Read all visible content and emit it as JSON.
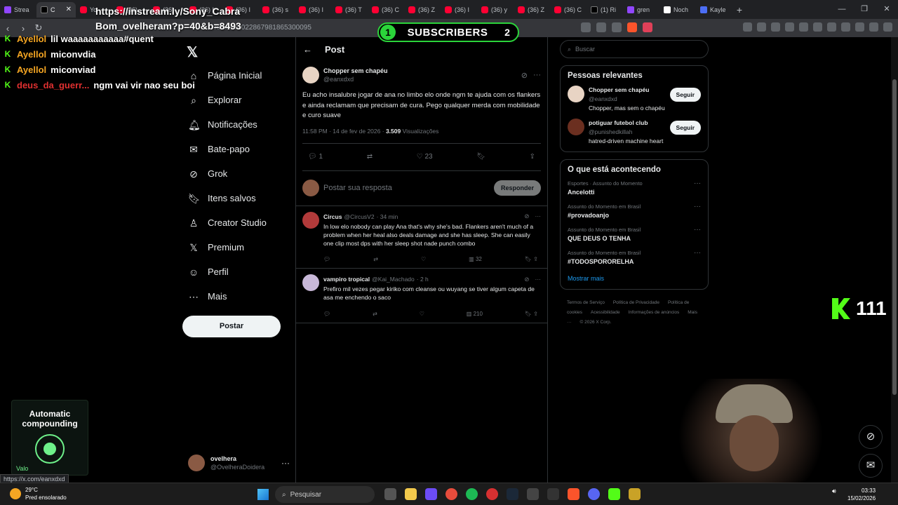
{
  "browser": {
    "tabs": [
      {
        "label": "Strea",
        "icon": "twitch-icon"
      },
      {
        "label": "C",
        "icon": "x-icon",
        "active": true
      },
      {
        "label": "Yo",
        "icon": "youtube-icon"
      },
      {
        "label": "(36)",
        "icon": "youtube-icon"
      },
      {
        "label": "(36)",
        "icon": "youtube-icon"
      },
      {
        "label": "(36) I",
        "icon": "youtube-icon"
      },
      {
        "label": "(36) I",
        "icon": "youtube-icon"
      },
      {
        "label": "(36) s",
        "icon": "youtube-icon"
      },
      {
        "label": "(36) I",
        "icon": "youtube-icon"
      },
      {
        "label": "(36) T",
        "icon": "youtube-icon"
      },
      {
        "label": "(36) C",
        "icon": "youtube-icon"
      },
      {
        "label": "(36) Z",
        "icon": "youtube-icon"
      },
      {
        "label": "(36) I",
        "icon": "youtube-icon"
      },
      {
        "label": "(36) y",
        "icon": "youtube-icon"
      },
      {
        "label": "(36) Z",
        "icon": "youtube-icon"
      },
      {
        "label": "(36) C",
        "icon": "youtube-icon"
      },
      {
        "label": "(1) Ri",
        "icon": "x-icon"
      },
      {
        "label": "gren",
        "icon": "twitch-icon"
      },
      {
        "label": "Noch",
        "icon": "notion-icon"
      },
      {
        "label": "Kayle",
        "icon": "blue-icon"
      }
    ],
    "url": "/status/2022867981865300095"
  },
  "overlay": {
    "link_line1": "https://instream.ly/Sony_Cabra",
    "link_line2": "Bom_ovelheram?p=40&b=8493",
    "subs_left": "1",
    "subs_label": "SUBSCRIBERS",
    "subs_right": "2",
    "kick_count": "111",
    "ad_title": "Automatic compounding",
    "ad_footer": "Valo",
    "status_url": "https://x.com/eanxdxd",
    "chat": [
      {
        "user": "Ayellol",
        "msg": "lil waaaaaaaaaaa#quent",
        "color": "orange"
      },
      {
        "user": "Ayellol",
        "msg": "miconvdia",
        "color": "orange"
      },
      {
        "user": "Ayellol",
        "msg": "miconviad",
        "color": "orange"
      },
      {
        "user": "deus_da_guerr...",
        "msg": "ngm vai vir nao seu boi",
        "color": "red"
      }
    ]
  },
  "nav": {
    "items": [
      {
        "label": "Página Inicial",
        "icon": "home-icon"
      },
      {
        "label": "Explorar",
        "icon": "search-icon"
      },
      {
        "label": "Notificações",
        "icon": "bell-icon"
      },
      {
        "label": "Bate-papo",
        "icon": "mail-icon"
      },
      {
        "label": "Grok",
        "icon": "grok-icon"
      },
      {
        "label": "Itens salvos",
        "icon": "bookmark-icon"
      },
      {
        "label": "Creator Studio",
        "icon": "creator-icon"
      },
      {
        "label": "Premium",
        "icon": "x-icon"
      },
      {
        "label": "Perfil",
        "icon": "person-icon"
      },
      {
        "label": "Mais",
        "icon": "more-icon"
      }
    ],
    "post_button": "Postar"
  },
  "account": {
    "name": "ovelhera",
    "handle": "@OvelheraDoidera"
  },
  "post": {
    "header": "Post",
    "author": "Chopper sem chapéu",
    "handle": "@eanxdxd",
    "text": "Eu acho insalubre jogar de ana no limbo elo onde ngm te ajuda com os flankers e ainda reclamam que precisam de cura. Pego qualquer merda com mobilidade e curo suave",
    "time": "11:58 PM · 14 de fev de 2026 ·",
    "views": "3.509",
    "views_label": "Visualizações",
    "replies": "1",
    "likes": "23",
    "reply_placeholder": "Postar sua resposta",
    "reply_button": "Responder"
  },
  "replies": [
    {
      "name": "Circus",
      "handle": "@CircusV2",
      "time": "· 34 min",
      "text": "In low elo nobody can play Ana that's why she's bad. Flankers aren't much of a problem when her heal also deals damage and she has sleep. She can easily one clip most dps with her sleep shot nade punch combo",
      "views": "32"
    },
    {
      "name": "vampiro tropical",
      "handle": "@Kai_Machado",
      "time": "· 2 h",
      "text": "Prefiro mil vezes pegar kiriko com cleanse ou wuyang se tiver algum capeta de asa me enchendo o saco",
      "views": "210"
    }
  ],
  "sidebar": {
    "search_placeholder": "Buscar",
    "relevant_title": "Pessoas relevantes",
    "people": [
      {
        "name": "Chopper sem chapéu",
        "handle": "@eanxdxd",
        "bio": "Chopper, mas sem o chapéu",
        "follow": "Seguir"
      },
      {
        "name": "potiguar futebol club",
        "handle": "@punishedkillah",
        "bio": "hatred-driven machine heart",
        "follow": "Seguir"
      }
    ],
    "trending_title": "O que está acontecendo",
    "trends": [
      {
        "category": "Esportes · Assunto do Momento",
        "name": "Ancelotti"
      },
      {
        "category": "Assunto do Momento em Brasil",
        "name": "#provadoanjo"
      },
      {
        "category": "Assunto do Momento em Brasil",
        "name": "QUE DEUS O TENHA"
      },
      {
        "category": "Assunto do Momento em Brasil",
        "name": "#TODOSPORORELHA"
      }
    ],
    "show_more": "Mostrar mais",
    "footer": [
      "Termos de Serviço",
      "Política de Privacidade",
      "Política de cookies",
      "Acessibilidade",
      "Informações de anúncios",
      "Mais ···",
      "© 2026 X Corp."
    ]
  },
  "taskbar": {
    "temp": "29°C",
    "weather": "Pred ensolarado",
    "search": "Pesquisar",
    "time": "03:33",
    "date": "15/02/2026"
  }
}
